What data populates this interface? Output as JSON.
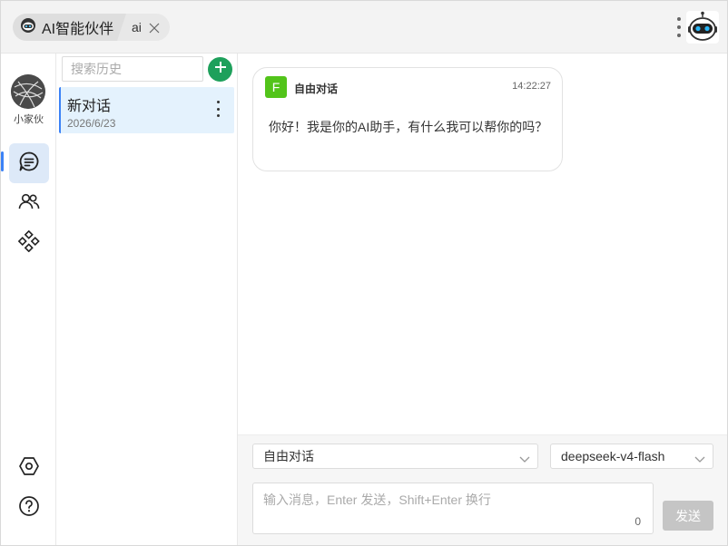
{
  "header": {
    "app_tab_label": "AI智能伙伴",
    "sub_tab_label": "ai"
  },
  "rail": {
    "user_name": "小家伙",
    "nav": [
      {
        "name": "chat",
        "icon": "chat-bubble-icon",
        "active": true
      },
      {
        "name": "contacts",
        "icon": "users-icon",
        "active": false
      },
      {
        "name": "apps",
        "icon": "diamond-grid-icon",
        "active": false
      }
    ],
    "bottom": [
      {
        "name": "settings",
        "icon": "hexagon-gear-icon"
      },
      {
        "name": "help",
        "icon": "help-circle-icon"
      }
    ]
  },
  "history": {
    "search_placeholder": "搜索历史",
    "conversations": [
      {
        "title": "新对话",
        "date": "2026/6/23"
      }
    ]
  },
  "chat": {
    "messages": [
      {
        "badge": "F",
        "sender": "自由对话",
        "time": "14:22:27",
        "text": "你好！我是你的AI助手，有什么我可以帮你的吗？"
      }
    ]
  },
  "controls": {
    "mode_select": "自由对话",
    "model_select": "deepseek-v4-flash"
  },
  "composer": {
    "placeholder": "输入消息，Enter 发送，Shift+Enter 换行",
    "char_count": "0",
    "send_label": "发送"
  },
  "colors": {
    "accent_blue": "#3b82f6",
    "add_button_green": "#1ea05b",
    "badge_green": "#52c41a",
    "active_item_bg": "#e4f2fd",
    "send_disabled": "#c5c5c5"
  }
}
